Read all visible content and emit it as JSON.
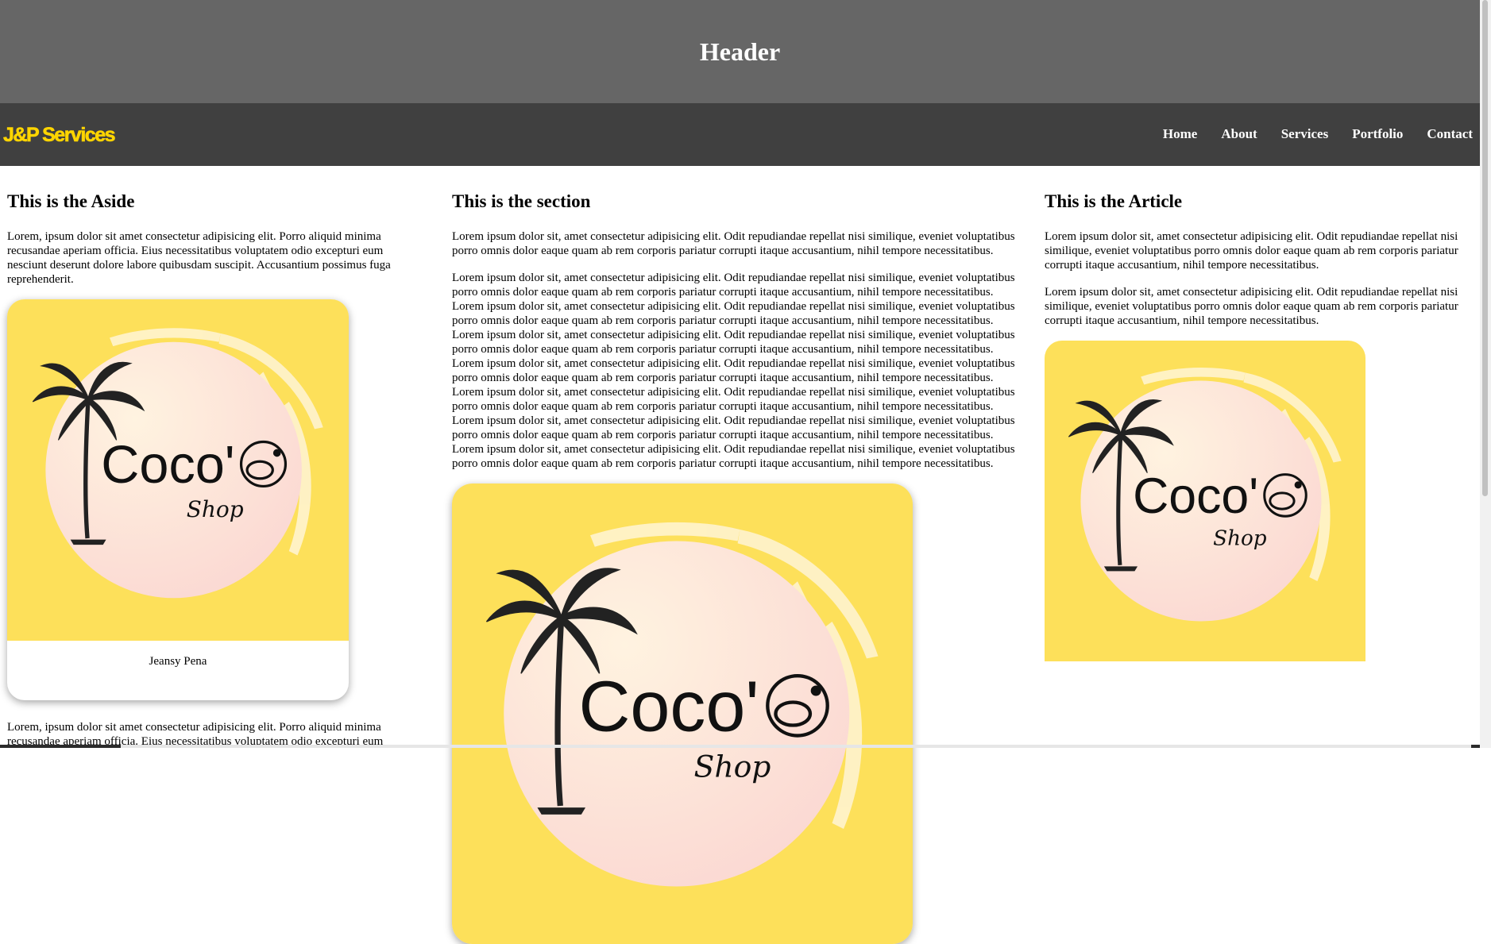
{
  "header": {
    "title": "Header"
  },
  "nav": {
    "brand": "J&P Services",
    "links": [
      "Home",
      "About",
      "Services",
      "Portfolio",
      "Contact"
    ]
  },
  "aside": {
    "heading": "This is the Aside",
    "intro": "Lorem, ipsum dolor sit amet consectetur adipisicing elit. Porro aliquid minima recusandae aperiam officia. Eius necessitatibus voluptatem odio excepturi eum nesciunt deserunt dolore labore quibusdam suscipit. Accusantium possimus fuga reprehenderit.",
    "card_name": "Jeansy Pena",
    "after": "Lorem, ipsum dolor sit amet consectetur adipisicing elit. Porro aliquid minima recusandae aperiam officia. Eius necessitatibus voluptatem odio excepturi eum"
  },
  "section": {
    "heading": "This is the section",
    "p1": "Lorem ipsum dolor sit, amet consectetur adipisicing elit. Odit repudiandae repellat nisi similique, eveniet voluptatibus porro omnis dolor eaque quam ab rem corporis pariatur corrupti itaque accusantium, nihil tempore necessitatibus.",
    "p2": "Lorem ipsum dolor sit, amet consectetur adipisicing elit. Odit repudiandae repellat nisi similique, eveniet voluptatibus porro omnis dolor eaque quam ab rem corporis pariatur corrupti itaque accusantium, nihil tempore necessitatibus. Lorem ipsum dolor sit, amet consectetur adipisicing elit. Odit repudiandae repellat nisi similique, eveniet voluptatibus porro omnis dolor eaque quam ab rem corporis pariatur corrupti itaque accusantium, nihil tempore necessitatibus. Lorem ipsum dolor sit, amet consectetur adipisicing elit. Odit repudiandae repellat nisi similique, eveniet voluptatibus porro omnis dolor eaque quam ab rem corporis pariatur corrupti itaque accusantium, nihil tempore necessitatibus. Lorem ipsum dolor sit, amet consectetur adipisicing elit. Odit repudiandae repellat nisi similique, eveniet voluptatibus porro omnis dolor eaque quam ab rem corporis pariatur corrupti itaque accusantium, nihil tempore necessitatibus. Lorem ipsum dolor sit, amet consectetur adipisicing elit. Odit repudiandae repellat nisi similique, eveniet voluptatibus porro omnis dolor eaque quam ab rem corporis pariatur corrupti itaque accusantium, nihil tempore necessitatibus. Lorem ipsum dolor sit, amet consectetur adipisicing elit. Odit repudiandae repellat nisi similique, eveniet voluptatibus porro omnis dolor eaque quam ab rem corporis pariatur corrupti itaque accusantium, nihil tempore necessitatibus. Lorem ipsum dolor sit, amet consectetur adipisicing elit. Odit repudiandae repellat nisi similique, eveniet voluptatibus porro omnis dolor eaque quam ab rem corporis pariatur corrupti itaque accusantium, nihil tempore necessitatibus."
  },
  "article": {
    "heading": "This is the Article",
    "p1": "Lorem ipsum dolor sit, amet consectetur adipisicing elit. Odit repudiandae repellat nisi similique, eveniet voluptatibus porro omnis dolor eaque quam ab rem corporis pariatur corrupti itaque accusantium, nihil tempore necessitatibus.",
    "p2": "Lorem ipsum dolor sit, amet consectetur adipisicing elit. Odit repudiandae repellat nisi similique, eveniet voluptatibus porro omnis dolor eaque quam ab rem corporis pariatur corrupti itaque accusantium, nihil tempore necessitatibus."
  },
  "logo": {
    "word": "Coco'",
    "sub": "Shop"
  },
  "colors": {
    "header_bg": "#666666",
    "nav_bg": "#404040",
    "brand": "#ffd500",
    "logo_bg": "#fde05a",
    "logo_circle": "#fde7dc"
  },
  "icons": [
    "palm-tree-icon",
    "coconut-icon"
  ]
}
